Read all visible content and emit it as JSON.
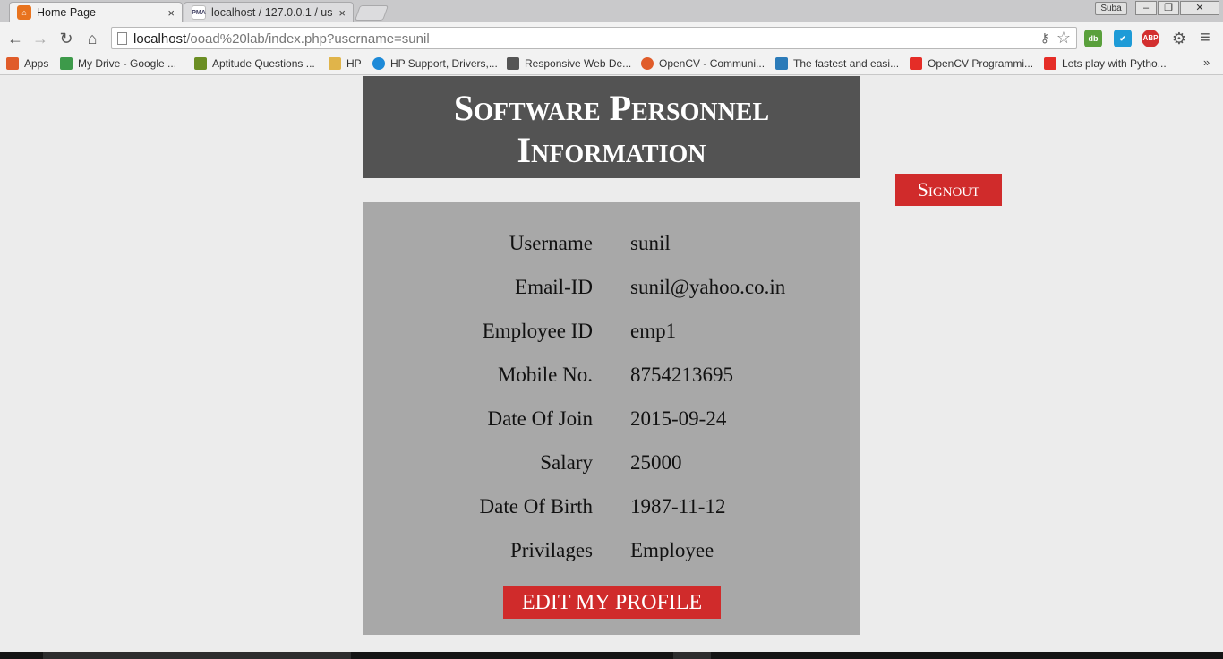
{
  "browser": {
    "tabs": [
      {
        "title": "Home Page",
        "favicon": "home-page-icon",
        "close": "×"
      },
      {
        "title": "localhost / 127.0.0.1 / use",
        "favicon": "phpmyadmin-icon",
        "close": "×"
      }
    ],
    "profile_name": "Suba",
    "window_controls": {
      "minimize": "–",
      "restore": "❐",
      "close": "✕"
    },
    "address": {
      "host": "localhost",
      "path": "/ooad%20lab/index.php?username=sunil"
    },
    "extensions": [
      {
        "name": "dashlane-icon",
        "label": "db",
        "color": "#5aa03c"
      },
      {
        "name": "checkmark-icon",
        "label": "✔",
        "color": "#1e9bd7"
      },
      {
        "name": "adblock-plus-icon",
        "label": "ABP",
        "color": "#d32f2f"
      }
    ],
    "bookmarks": [
      {
        "label": "Apps",
        "icon": "apps-grid-icon",
        "color": "#e05c2a"
      },
      {
        "label": "My Drive - Google ...",
        "icon": "google-drive-icon",
        "color": "#3d9a4a"
      },
      {
        "label": "Aptitude Questions ...",
        "icon": "aptitude-icon",
        "color": "#6b8e23"
      },
      {
        "label": "HP",
        "icon": "folder-icon",
        "color": "#e0b44a"
      },
      {
        "label": "HP Support, Drivers,...",
        "icon": "hp-icon",
        "color": "#1d8ad8"
      },
      {
        "label": "Responsive Web De...",
        "icon": "code-icon",
        "color": "#555555"
      },
      {
        "label": "OpenCV - Communi...",
        "icon": "opencv-icon",
        "color": "#e05c2a"
      },
      {
        "label": "The fastest and easi...",
        "icon": "wordpress-icon",
        "color": "#2b7bb9"
      },
      {
        "label": "OpenCV Programmi...",
        "icon": "youtube-icon",
        "color": "#e52d27"
      },
      {
        "label": "Lets play with Pytho...",
        "icon": "youtube-icon",
        "color": "#e52d27"
      }
    ],
    "bookmarks_more": "»"
  },
  "page": {
    "title_line1": "Software Personnel",
    "title_line2": "Information",
    "signout_label": "Signout",
    "fields": [
      {
        "label": "Username",
        "value": "sunil"
      },
      {
        "label": "Email-ID",
        "value": "sunil@yahoo.co.in"
      },
      {
        "label": "Employee ID",
        "value": "emp1"
      },
      {
        "label": "Mobile No.",
        "value": "8754213695"
      },
      {
        "label": "Date Of Join",
        "value": "2015-09-24"
      },
      {
        "label": "Salary",
        "value": "25000"
      },
      {
        "label": "Date Of Birth",
        "value": "1987-11-12"
      },
      {
        "label": "Privilages",
        "value": "Employee"
      }
    ],
    "edit_profile_label": "EDIT MY PROFILE"
  },
  "colors": {
    "header_bg": "#535353",
    "info_bg": "#a8a8a8",
    "accent_red": "#d02b2b",
    "page_bg": "#ececec"
  }
}
